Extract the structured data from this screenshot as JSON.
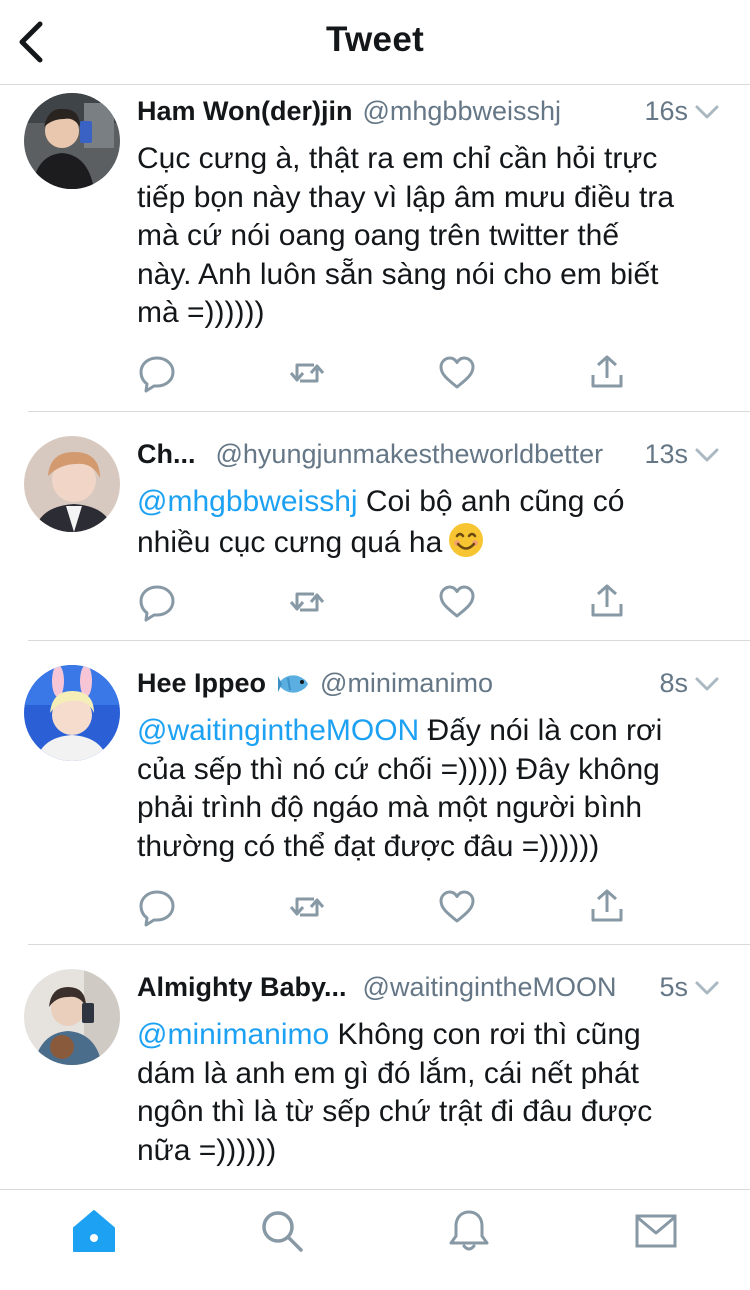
{
  "header": {
    "title": "Tweet"
  },
  "colors": {
    "accent": "#1da1f2",
    "text": "#14171a",
    "secondary": "#657786",
    "icon": "#8899a6"
  },
  "tweets": [
    {
      "name": "Ham Won(der)jin",
      "handle": "@mhgbbweisshj",
      "time": "16s",
      "lines": [
        "Cục cưng à, thật ra em chỉ cần hỏi trực",
        "tiếp bọn này thay vì lập âm mưu điều tra",
        "mà cứ nói oang oang trên twitter thế",
        "này. Anh luôn sẵn sàng nói cho em biết",
        "mà =))))))"
      ]
    },
    {
      "name": "Ch...",
      "handle": "@hyungjunmakestheworldbetter",
      "time": "13s",
      "mention": "@mhgbbweisshj",
      "line1_rest": " Coi bộ anh cũng có",
      "line2": "nhiều cục cưng quá ha"
    },
    {
      "name": "Hee Ippeo",
      "name_emoji": "fish-emoji",
      "handle": "@minimanimo",
      "time": "8s",
      "mention": "@waitingintheMOON",
      "line1_rest": " Đấy nói là con rơi",
      "lines": [
        "của sếp thì nó cứ chối =))))) Đây không",
        "phải trình độ ngáo mà một người bình",
        "thường có thể đạt được đâu =))))))"
      ]
    },
    {
      "name": "Almighty Baby...",
      "handle": "@waitingintheMOON",
      "time": "5s",
      "mention": "@minimanimo",
      "line1_rest": " Không con rơi thì cũng",
      "lines": [
        "dám là anh em gì đó lắm, cái nết phát",
        "ngôn thì là từ sếp chứ trật đi đâu được",
        "nữa =))))))"
      ]
    }
  ],
  "tabbar": {
    "icons": [
      "home-icon",
      "search-icon",
      "notifications-icon",
      "messages-icon"
    ],
    "active": "home-icon"
  }
}
